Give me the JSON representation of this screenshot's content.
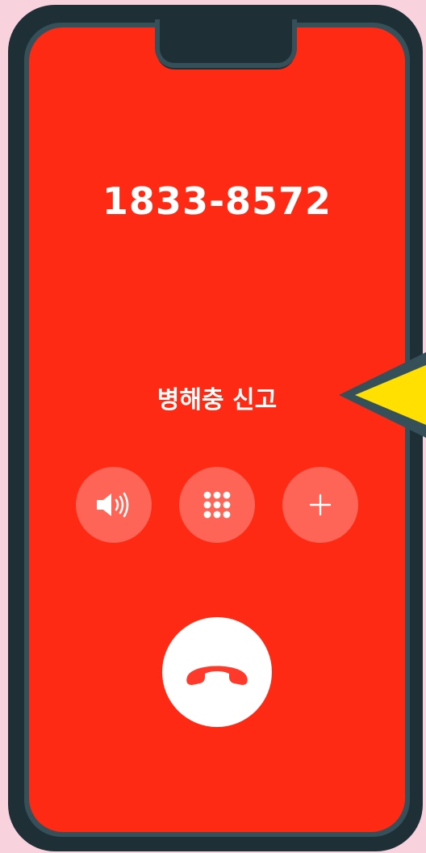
{
  "call": {
    "number": "1833-8572",
    "label": "병해충 신고"
  },
  "controls": {
    "items": [
      {
        "icon": "speaker-icon"
      },
      {
        "icon": "keypad-icon"
      },
      {
        "icon": "plus-icon"
      }
    ],
    "end_call_icon": "hang-up-icon"
  },
  "colors": {
    "background": "#f8d3dd",
    "screen": "#ff2a14",
    "button": "#ff6556",
    "frame": "#1f2f36",
    "pointer": "#ffe000"
  }
}
